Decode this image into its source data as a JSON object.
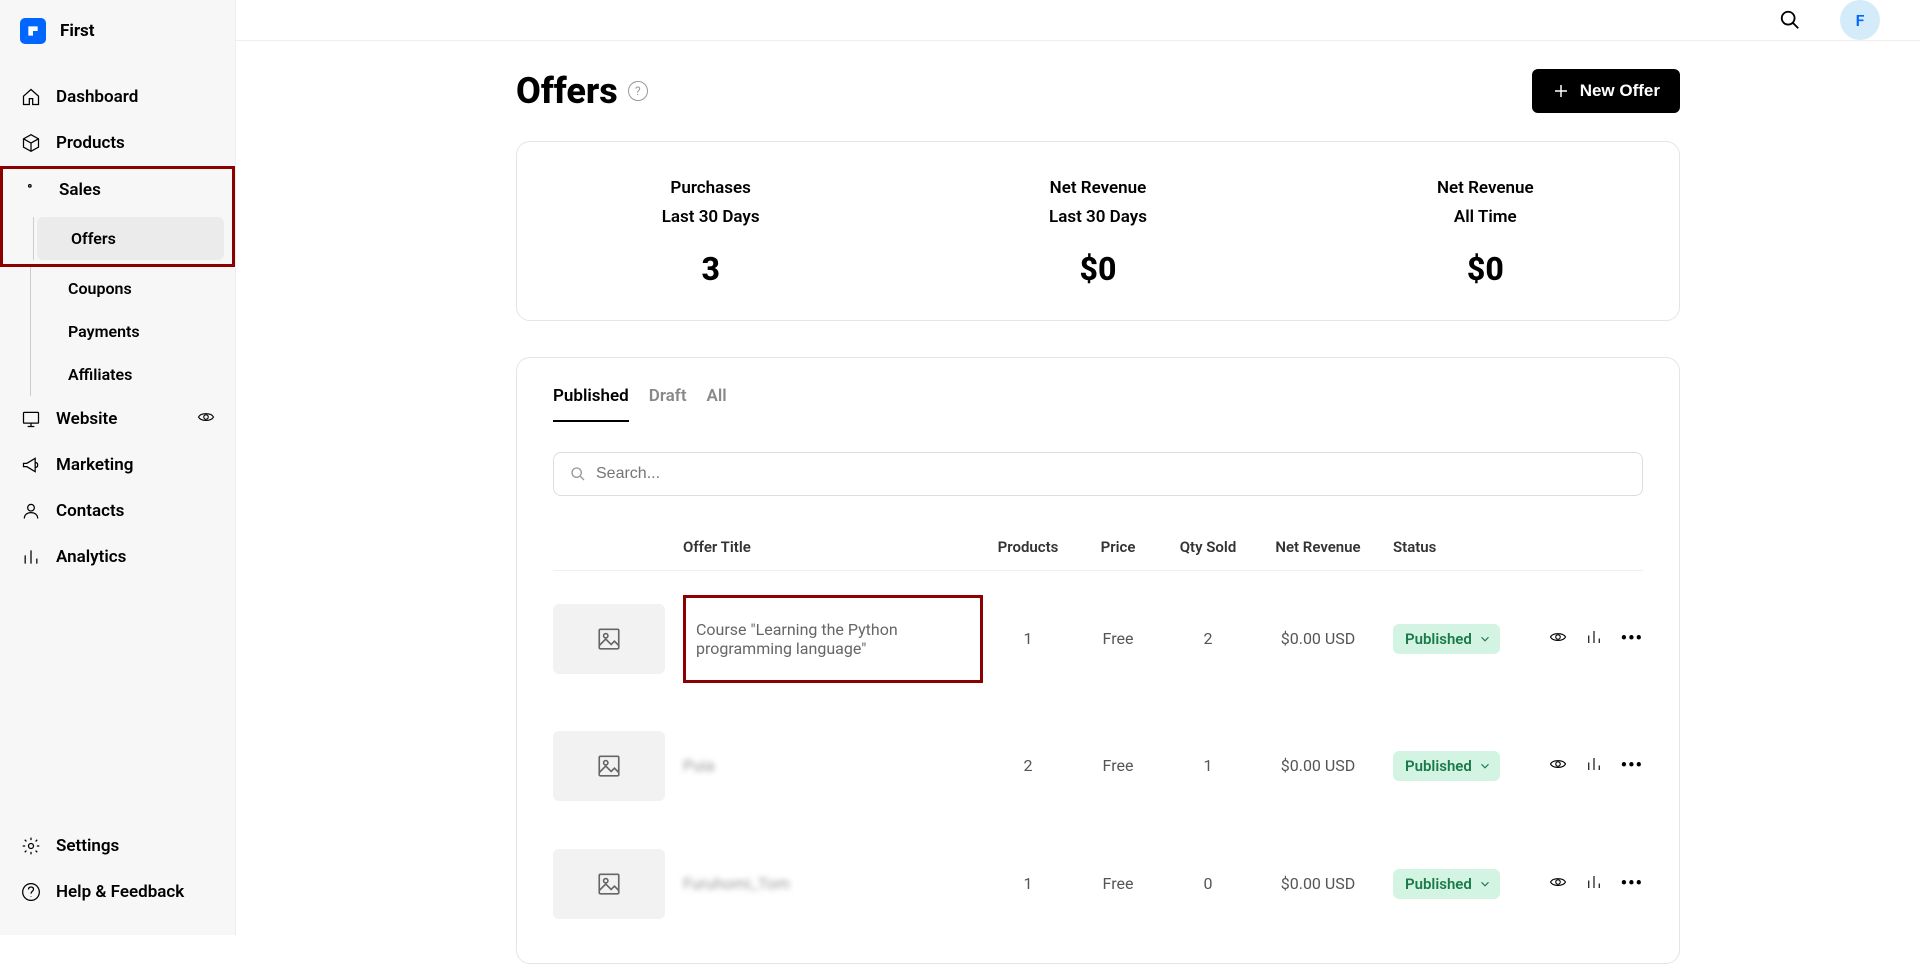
{
  "brand": "First",
  "avatar_letter": "F",
  "sidebar": {
    "dashboard": "Dashboard",
    "products": "Products",
    "sales": "Sales",
    "offers": "Offers",
    "coupons": "Coupons",
    "payments": "Payments",
    "affiliates": "Affiliates",
    "website": "Website",
    "marketing": "Marketing",
    "contacts": "Contacts",
    "analytics": "Analytics",
    "settings": "Settings",
    "help": "Help & Feedback"
  },
  "page": {
    "title": "Offers",
    "new_offer_btn": "New Offer"
  },
  "stats": [
    {
      "label1": "Purchases",
      "label2": "Last 30 Days",
      "value": "3"
    },
    {
      "label1": "Net Revenue",
      "label2": "Last 30 Days",
      "value": "$0"
    },
    {
      "label1": "Net Revenue",
      "label2": "All Time",
      "value": "$0"
    }
  ],
  "tabs": {
    "published": "Published",
    "draft": "Draft",
    "all": "All"
  },
  "search_placeholder": "Search...",
  "columns": {
    "title": "Offer Title",
    "products": "Products",
    "price": "Price",
    "qty": "Qty Sold",
    "revenue": "Net Revenue",
    "status": "Status"
  },
  "rows": [
    {
      "title": "Course \"Learning the Python programming language\"",
      "products": "1",
      "price": "Free",
      "qty": "2",
      "revenue": "$0.00 USD",
      "status": "Published"
    },
    {
      "title": "Puia",
      "products": "2",
      "price": "Free",
      "qty": "1",
      "revenue": "$0.00 USD",
      "status": "Published"
    },
    {
      "title": "Furuhomi_Tom",
      "products": "1",
      "price": "Free",
      "qty": "0",
      "revenue": "$0.00 USD",
      "status": "Published"
    }
  ]
}
